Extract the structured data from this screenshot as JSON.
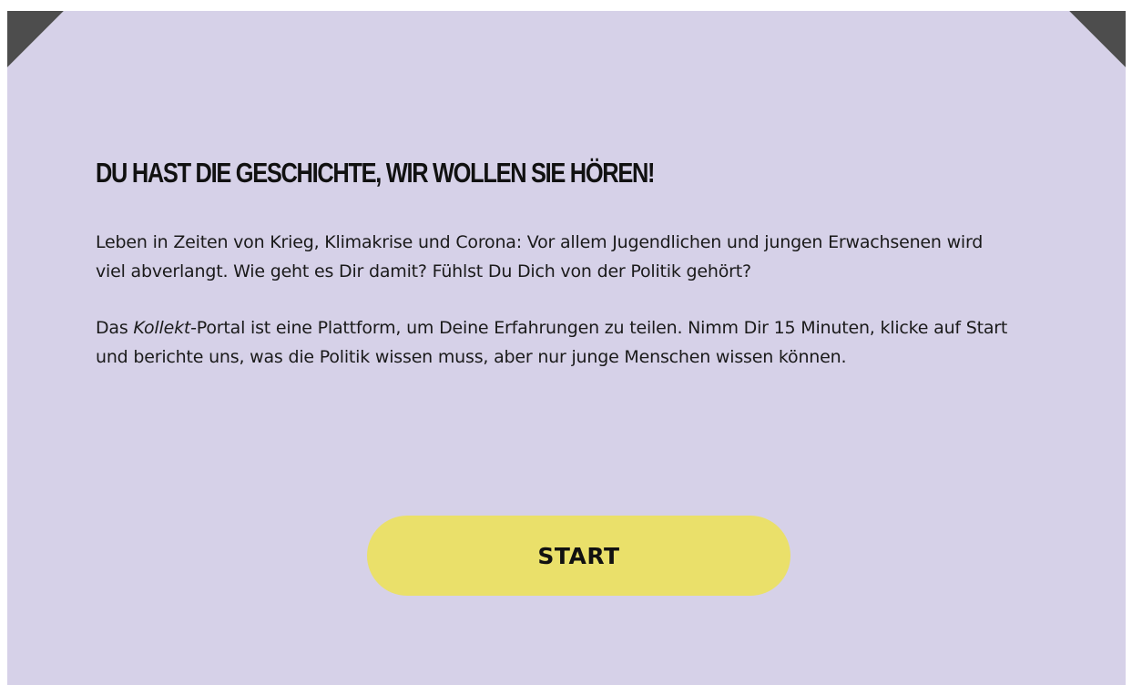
{
  "colors": {
    "card_background": "#d6d1e8",
    "corner_dark": "#4d4d4d",
    "button_background": "#eae06a",
    "text": "#111111"
  },
  "intro": {
    "heading": "DU HAST DIE GESCHICHTE, WIR WOLLEN SIE HÖREN!",
    "paragraph_1": "Leben in Zeiten von Krieg, Klimakrise und Corona: Vor allem Jugendlichen und jungen Erwachsenen wird viel abverlangt. Wie geht es Dir damit? Fühlst Du Dich von der Politik gehört?",
    "paragraph_2": {
      "prefix": "Das ",
      "brand": "Kollekt",
      "suffix": "-Portal ist eine Plattform, um Deine Erfahrungen zu teilen. Nimm Dir 15 Minuten, klicke auf Start und berichte uns, was die Politik wissen muss, aber nur junge Menschen wissen können."
    }
  },
  "start_button": {
    "label": "START"
  }
}
